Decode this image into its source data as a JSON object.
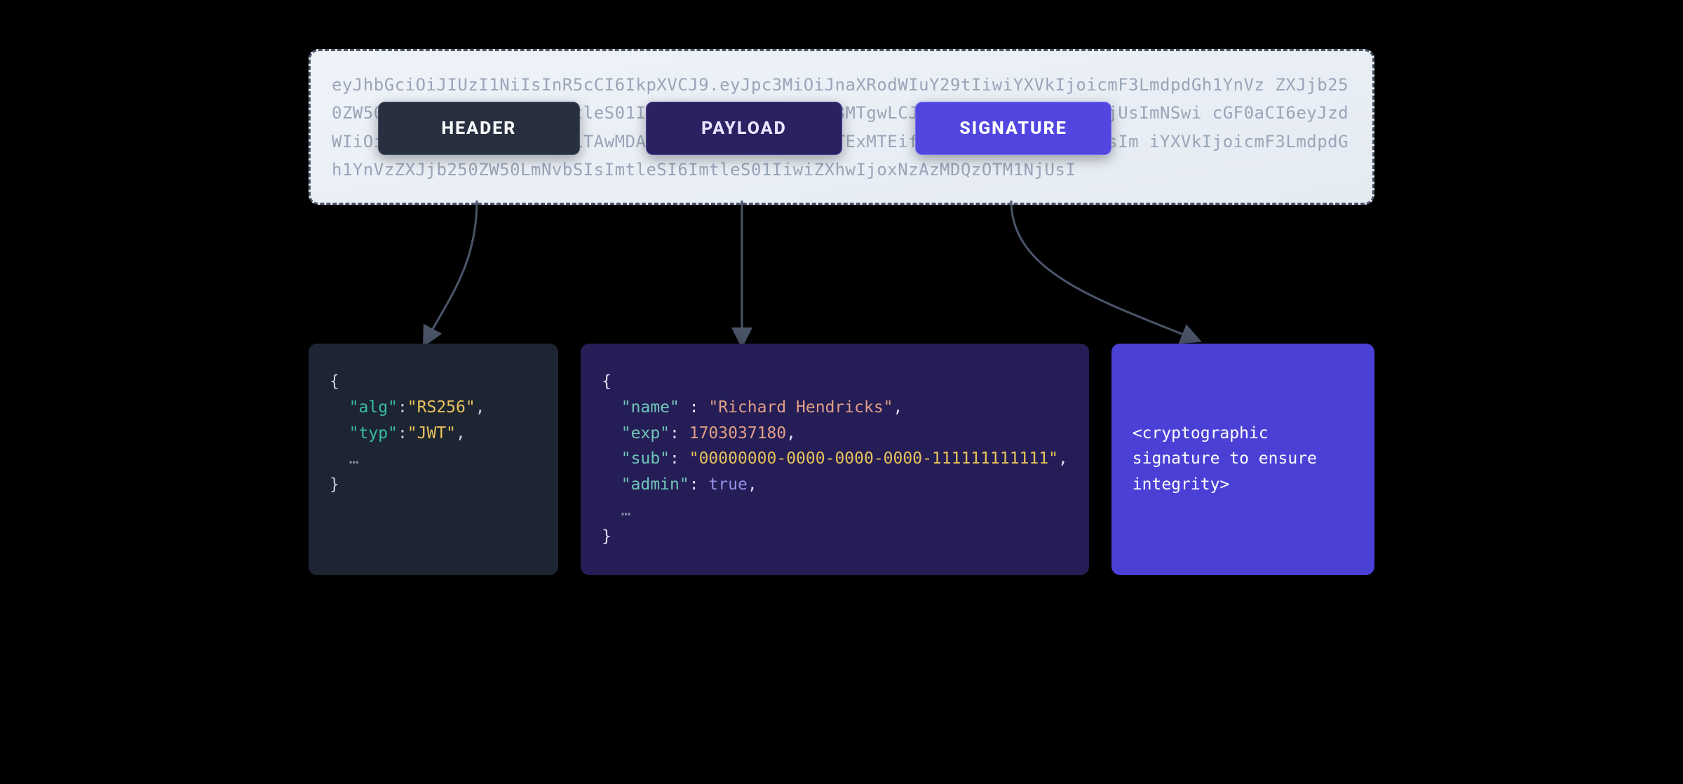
{
  "token": {
    "line1": "eyJhbGciOiJIUzI1NiIsInR5cCI6IkpXVCJ9.eyJpc3MiOiJnaXRodWIuY29tIiwiYXVkIjoicmF3LmdpdGh1YnVz",
    "line2": "ZXJjb250ZW50LmNvbSIsImtleSI6ImtleS01IiwiZXhwIjoxNzAzMDM3MTgwLCJuYW1lIjoiMDQzOTM1NjUsImNSwi",
    "line3": "cGF0aCI6eyJzdWIiOiIwMDAwMDAwMC0wMDAwLTAwMDAtMDAwMC0xMTExMTExMTExMTEifSwiYWRtaW4iOnRydWUsIm",
    "line4": "iYXVkIjoicmF3LmdpdGh1YnVzZXJjb250ZW50LmNvbSIsImtleSI6ImtleS01IiwiZXhwIjoxNzAzMDQzOTM1NjUsI"
  },
  "labels": {
    "header": "HEADER",
    "payload": "PAYLOAD",
    "signature": "SIGNATURE"
  },
  "header_code": {
    "alg_key": "\"alg\"",
    "alg_val": "\"RS256\"",
    "typ_key": "\"typ\"",
    "typ_val": "\"JWT\"",
    "ellipsis": "…"
  },
  "payload_code": {
    "name_key": "\"name\"",
    "name_val": "\"Richard Hendricks\"",
    "exp_key": "\"exp\"",
    "exp_val": "1703037180",
    "sub_key": "\"sub\"",
    "sub_val": "\"00000000-0000-0000-0000-111111111111\"",
    "admin_key": "\"admin\"",
    "admin_val": "true",
    "ellipsis": "…"
  },
  "signature_text": "<cryptographic signature to ensure integrity>",
  "colors": {
    "bg": "#000000",
    "header_panel": "#1e2532",
    "payload_panel": "#241d56",
    "signature_panel": "#4b40d6",
    "header_label": "#28303f",
    "payload_label": "#2a2260",
    "signature_label": "#5246e0",
    "token_box_bg": "#eff3f9",
    "token_text": "#9aa5b8",
    "arrow": "#4a5568"
  }
}
